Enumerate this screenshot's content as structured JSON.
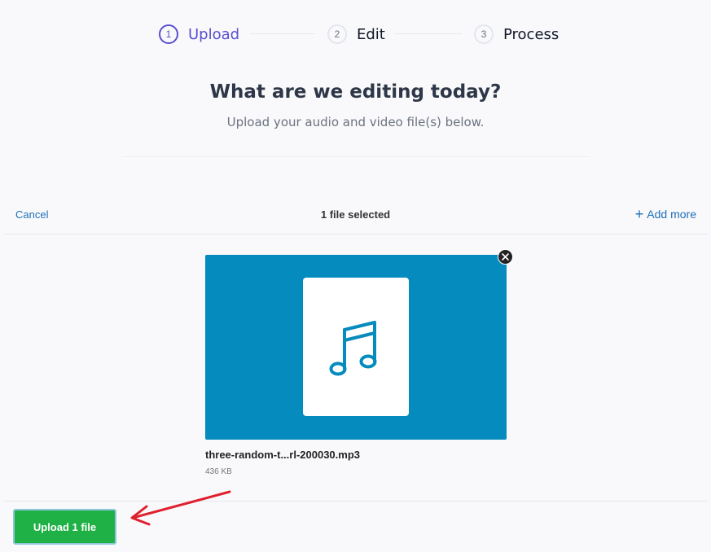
{
  "stepper": {
    "steps": [
      {
        "number": "1",
        "label": "Upload"
      },
      {
        "number": "2",
        "label": "Edit"
      },
      {
        "number": "3",
        "label": "Process"
      }
    ],
    "active_index": 0
  },
  "header": {
    "title": "What are we editing today?",
    "subtitle": "Upload your audio and video file(s) below."
  },
  "uploader": {
    "cancel_label": "Cancel",
    "selection_status": "1 file selected",
    "add_more_label": "Add more",
    "file": {
      "name": "three-random-t...rl-200030.mp3",
      "size": "436 KB",
      "icon": "music-note-icon"
    },
    "upload_button_label": "Upload 1 file"
  },
  "colors": {
    "accent": "#5a4fcf",
    "link": "#1e6fb8",
    "preview_bg": "#058bbd",
    "upload_button": "#1fb146",
    "annotation_arrow": "#e0202e"
  }
}
